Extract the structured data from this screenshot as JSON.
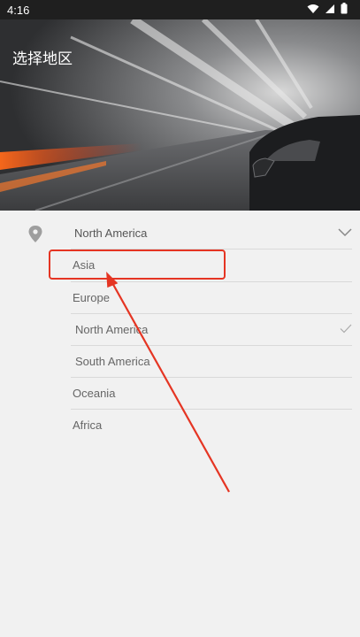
{
  "status_bar": {
    "time": "4:16",
    "icons": [
      "wifi-icon",
      "signal-icon",
      "battery-icon"
    ]
  },
  "header": {
    "title": "选择地区"
  },
  "region_selector": {
    "selected": "North America",
    "icon": "location-pin-icon"
  },
  "region_options": [
    {
      "label": "Asia"
    },
    {
      "label": "Europe"
    },
    {
      "label": "North America",
      "checked": true
    },
    {
      "label": "South America"
    },
    {
      "label": "Oceania"
    },
    {
      "label": "Africa"
    }
  ],
  "annotation": {
    "color": "#e53523"
  }
}
